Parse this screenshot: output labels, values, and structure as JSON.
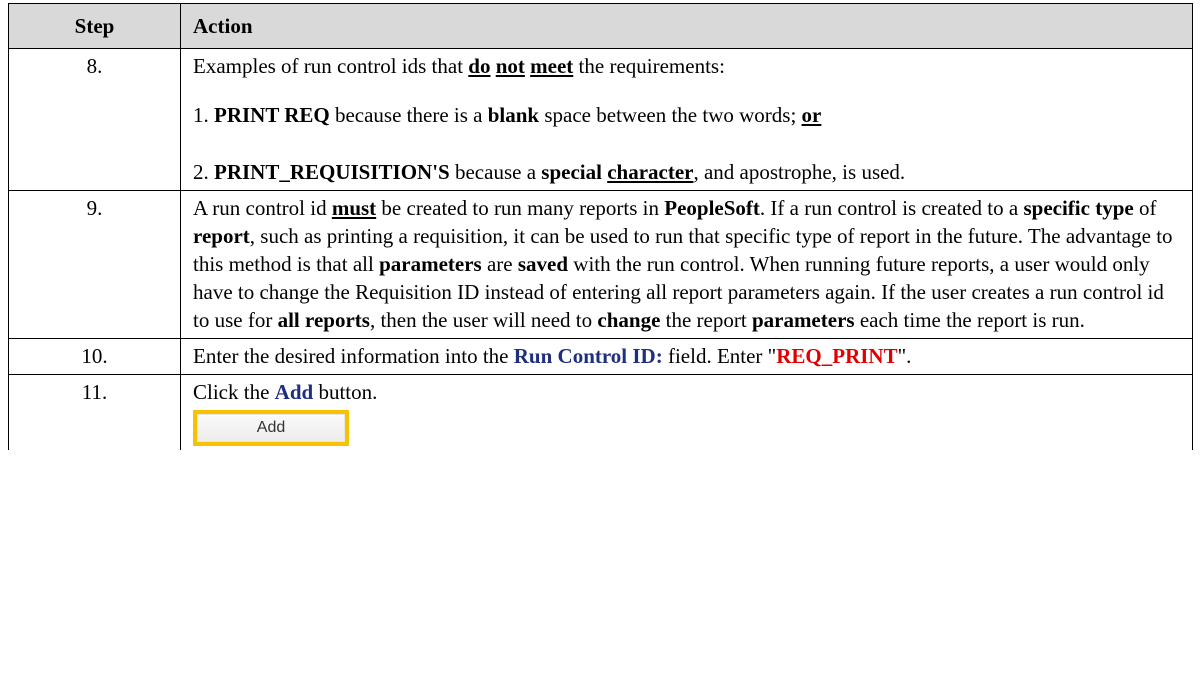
{
  "header": {
    "step": "Step",
    "action": "Action"
  },
  "rows": [
    {
      "step": "8.",
      "line1": {
        "pre": "Examples of run control ids that ",
        "do": "do",
        "not": "not",
        "meet": "meet",
        "post": " the requirements:"
      },
      "line2": {
        "pre": "1. ",
        "b1": "PRINT REQ",
        "mid1": " because there is a ",
        "b2": "blank",
        "mid2": " space between the two words; ",
        "or": "or"
      },
      "line3": {
        "pre": "2. ",
        "b1": "PRINT_REQUISITION'S",
        "mid1": " because a ",
        "b2": "special",
        "b3": "character",
        "post": ", and apostrophe, is used."
      }
    },
    {
      "step": "9.",
      "t1": "A run control id ",
      "must": "must",
      "t2": " be created to run many reports in ",
      "peoplesoft": "PeopleSoft",
      "t3": ". If a run control is created to a ",
      "specific_type": "specific type",
      "t4": " of ",
      "report": "report",
      "t5": ", such as printing a requisition, it can be used to run that specific type of report in the future. The advantage to this method is that all ",
      "parameters1": "parameters",
      "t6": " are ",
      "saved": "saved",
      "t7": " with the run control. When running future reports, a user would only have to change the Requisition ID instead of entering all report parameters again. If the user creates a run control id to use for ",
      "all_reports": "all reports",
      "t8": ", then the user will need to ",
      "change": "change",
      "t9": " the report ",
      "parameters2": "parameters",
      "t10": " each time the report is run."
    },
    {
      "step": "10.",
      "t1": "Enter the desired information into the ",
      "field": "Run Control ID:",
      "t2": " field. Enter \"",
      "value": "REQ_PRINT",
      "t3": "\"."
    },
    {
      "step": "11.",
      "t1": "Click the ",
      "button_ref": "Add",
      "t2": " button.",
      "button_label": "Add"
    }
  ],
  "colors": {
    "header_bg": "#d9d9d9",
    "blue_text": "#1f2f80",
    "red_text": "#e00000",
    "button_border": "#f7c300"
  }
}
